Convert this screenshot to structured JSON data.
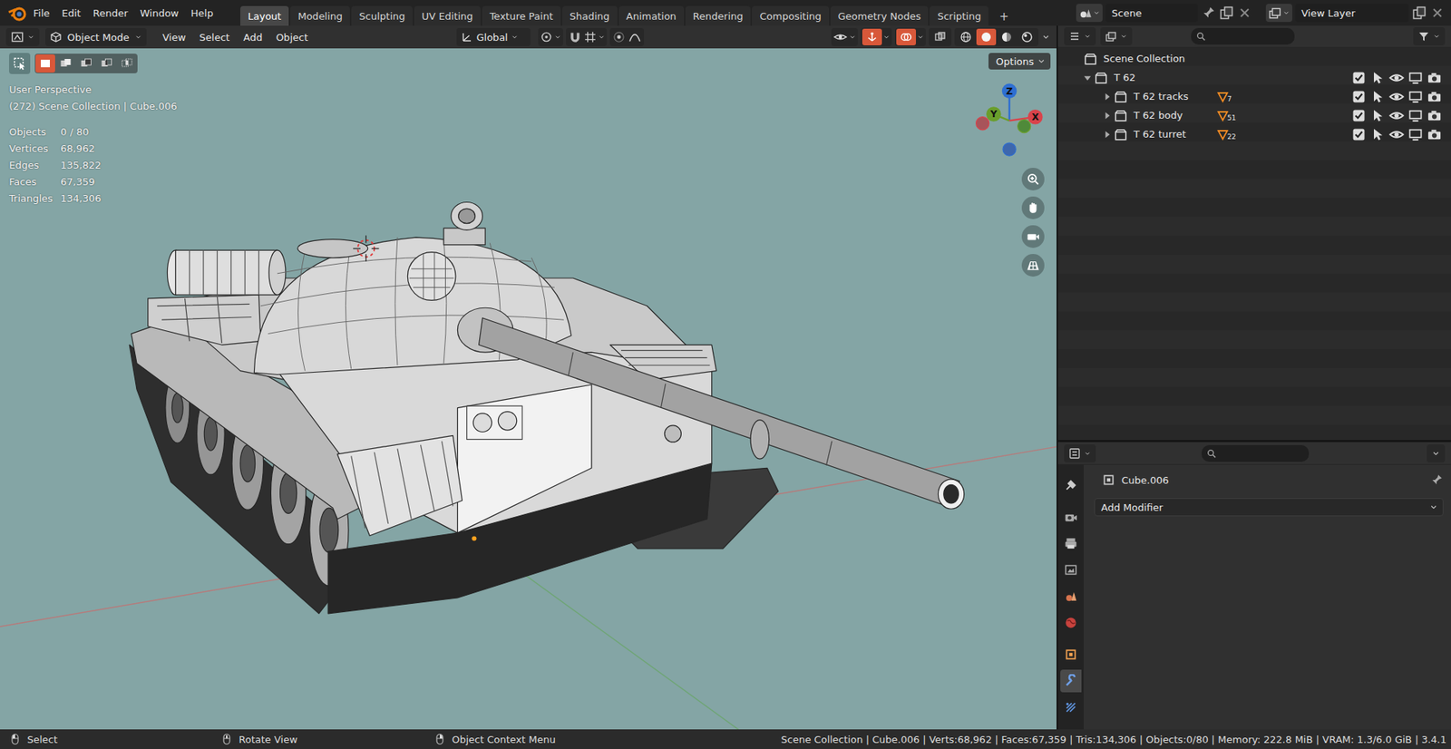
{
  "topbar": {
    "menus": [
      "File",
      "Edit",
      "Render",
      "Window",
      "Help"
    ],
    "workspaces": [
      {
        "label": "Layout",
        "selected": true
      },
      {
        "label": "Modeling",
        "selected": false
      },
      {
        "label": "Sculpting",
        "selected": false
      },
      {
        "label": "UV Editing",
        "selected": false
      },
      {
        "label": "Texture Paint",
        "selected": false
      },
      {
        "label": "Shading",
        "selected": false
      },
      {
        "label": "Animation",
        "selected": false
      },
      {
        "label": "Rendering",
        "selected": false
      },
      {
        "label": "Compositing",
        "selected": false
      },
      {
        "label": "Geometry Nodes",
        "selected": false
      },
      {
        "label": "Scripting",
        "selected": false
      }
    ],
    "add_workspace": "+",
    "scene": "Scene",
    "view_layer": "View Layer"
  },
  "viewport": {
    "header": {
      "mode": "Object Mode",
      "menus": [
        "View",
        "Select",
        "Add",
        "Object"
      ],
      "orientation": "Global",
      "toggles": [
        {
          "kind": "gizmos",
          "on": true
        },
        {
          "kind": "overlays",
          "on": true
        },
        {
          "kind": "xray",
          "on": false
        }
      ],
      "shading": [
        {
          "kind": "wireframe",
          "selected": false
        },
        {
          "kind": "solid",
          "selected": true
        },
        {
          "kind": "material",
          "selected": false
        },
        {
          "kind": "rendered",
          "selected": false
        }
      ]
    },
    "select_modes": [
      {
        "kind": "set",
        "selected": true
      },
      {
        "kind": "extend",
        "selected": false
      },
      {
        "kind": "subtract",
        "selected": false
      },
      {
        "kind": "difference",
        "selected": false
      },
      {
        "kind": "intersect",
        "selected": false
      }
    ],
    "options": "Options",
    "view_name": "User Perspective",
    "context": "(272) Scene Collection | Cube.006",
    "stats": [
      {
        "label": "Objects",
        "value": "0 / 80"
      },
      {
        "label": "Vertices",
        "value": "68,962"
      },
      {
        "label": "Edges",
        "value": "135,822"
      },
      {
        "label": "Faces",
        "value": "67,359"
      },
      {
        "label": "Triangles",
        "value": "134,306"
      }
    ],
    "gizmo": {
      "x": "X",
      "y": "Y",
      "z": "Z"
    }
  },
  "outliner": {
    "root": "Scene Collection",
    "collection": {
      "name": "T 62",
      "expanded": true,
      "include": true,
      "selectable": true,
      "visible": true,
      "viewport": true,
      "render": true
    },
    "children": [
      {
        "name": "T 62 tracks",
        "count": "7",
        "expanded": false,
        "include": true,
        "selectable": true,
        "visible": true,
        "viewport": true,
        "render": true
      },
      {
        "name": "T 62 body",
        "count": "51",
        "expanded": false,
        "include": true,
        "selectable": true,
        "visible": true,
        "viewport": true,
        "render": true
      },
      {
        "name": "T 62 turret",
        "count": "22",
        "expanded": false,
        "include": true,
        "selectable": true,
        "visible": true,
        "viewport": true,
        "render": true
      }
    ]
  },
  "properties": {
    "tabs": [
      {
        "kind": "tool",
        "selected": false
      },
      {
        "kind": "render",
        "selected": false
      },
      {
        "kind": "output",
        "selected": false
      },
      {
        "kind": "view_layer",
        "selected": false
      },
      {
        "kind": "scene",
        "selected": false
      },
      {
        "kind": "world",
        "selected": false
      },
      {
        "kind": "object",
        "selected": false
      },
      {
        "kind": "modifier",
        "selected": true
      },
      {
        "kind": "particles",
        "selected": false
      }
    ],
    "object": "Cube.006",
    "add_modifier": "Add Modifier"
  },
  "status_bar": {
    "hints": [
      {
        "button": "left",
        "label": "Select"
      },
      {
        "button": "middle",
        "label": "Rotate View"
      },
      {
        "button": "right",
        "label": "Object Context Menu"
      }
    ],
    "info": "Scene Collection | Cube.006 | Verts:68,962 | Faces:67,359 | Tris:134,306 | Objects:0/80 | Memory: 222.8 MiB | VRAM: 1.3/6.0 GiB | 3.4.1"
  }
}
